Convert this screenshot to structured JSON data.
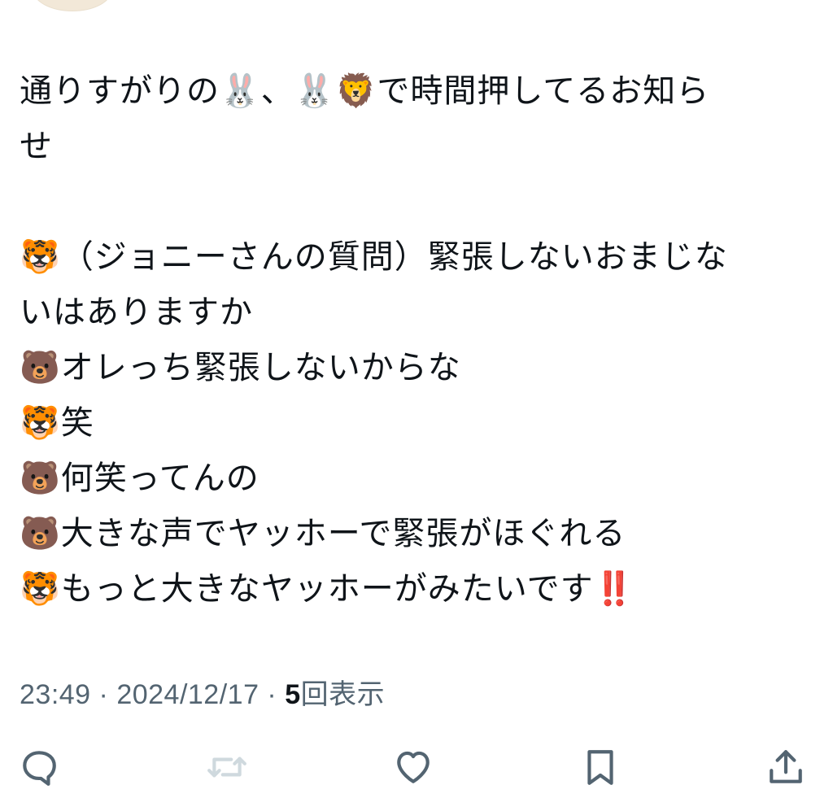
{
  "tweet": {
    "lines": [
      "通りすがりの🐰、🐰🦁で時間押してるお知ら",
      "せ",
      "",
      "🐯（ジョニーさんの質問）緊張しないおまじな",
      "いはありますか",
      "🐻オレっち緊張しないからな",
      "🐯笑",
      "🐻何笑ってんの",
      "🐻大きな声でヤッホーで緊張がほぐれる",
      "🐯もっと大きなヤッホーがみたいです‼️"
    ]
  },
  "meta": {
    "time": "23:49",
    "separator": " · ",
    "date": "2024/12/17",
    "views_count": "5",
    "views_label": "回表示"
  },
  "actions": {
    "reply_icon": "reply-icon",
    "retweet_icon": "retweet-icon",
    "like_icon": "heart-icon",
    "bookmark_icon": "bookmark-icon",
    "share_icon": "share-icon",
    "icon_color": "#536471",
    "retweet_disabled_color": "#cfd9de"
  }
}
